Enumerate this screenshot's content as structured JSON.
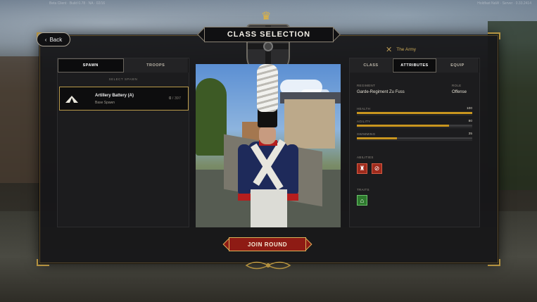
{
  "status": {
    "left": "Beta Client · Build 0.78 · NA · 02/16",
    "right": "Holdfast NaW · Server · 0.33.2414"
  },
  "nav": {
    "back_label": "Back"
  },
  "header": {
    "title": "CLASS SELECTION",
    "faction": "The Army"
  },
  "left_panel": {
    "tabs": [
      {
        "label": "SPAWN",
        "active": true
      },
      {
        "label": "TROOPS",
        "active": false
      }
    ],
    "subheading": "SELECT SPAWN",
    "spawn": {
      "name": "Artillery Battery (A)",
      "subtitle": "Base Spawn",
      "current": "0",
      "capacity": "/ 397",
      "icon": "tent-icon"
    }
  },
  "right_panel": {
    "tabs": [
      {
        "label": "CLASS",
        "active": false
      },
      {
        "label": "ATTRIBUTES",
        "active": true
      },
      {
        "label": "EQUIP",
        "active": false
      }
    ],
    "regiment_label": "REGIMENT",
    "regiment_value": "Garde-Regiment Zu Fuss",
    "role_label": "ROLE",
    "role_value": "Offense",
    "stats": [
      {
        "label": "HEALTH",
        "value": 100,
        "max": 100
      },
      {
        "label": "AGILITY",
        "value": 80,
        "max": 100
      },
      {
        "label": "SWIMMING",
        "value": 35,
        "max": 100
      }
    ],
    "abilities_label": "ABILITIES",
    "abilities": [
      "rally-troops-icon",
      "no-melee-icon"
    ],
    "traits_label": "TRAITS",
    "traits": [
      "spawn-point-icon"
    ]
  },
  "footer": {
    "join_label": "JOIN ROUND"
  },
  "colors": {
    "accent_gold": "#c8951f",
    "join_red": "#8e1b14",
    "ability_red": "#9e2a1c",
    "trait_green": "#2e7a2e"
  }
}
